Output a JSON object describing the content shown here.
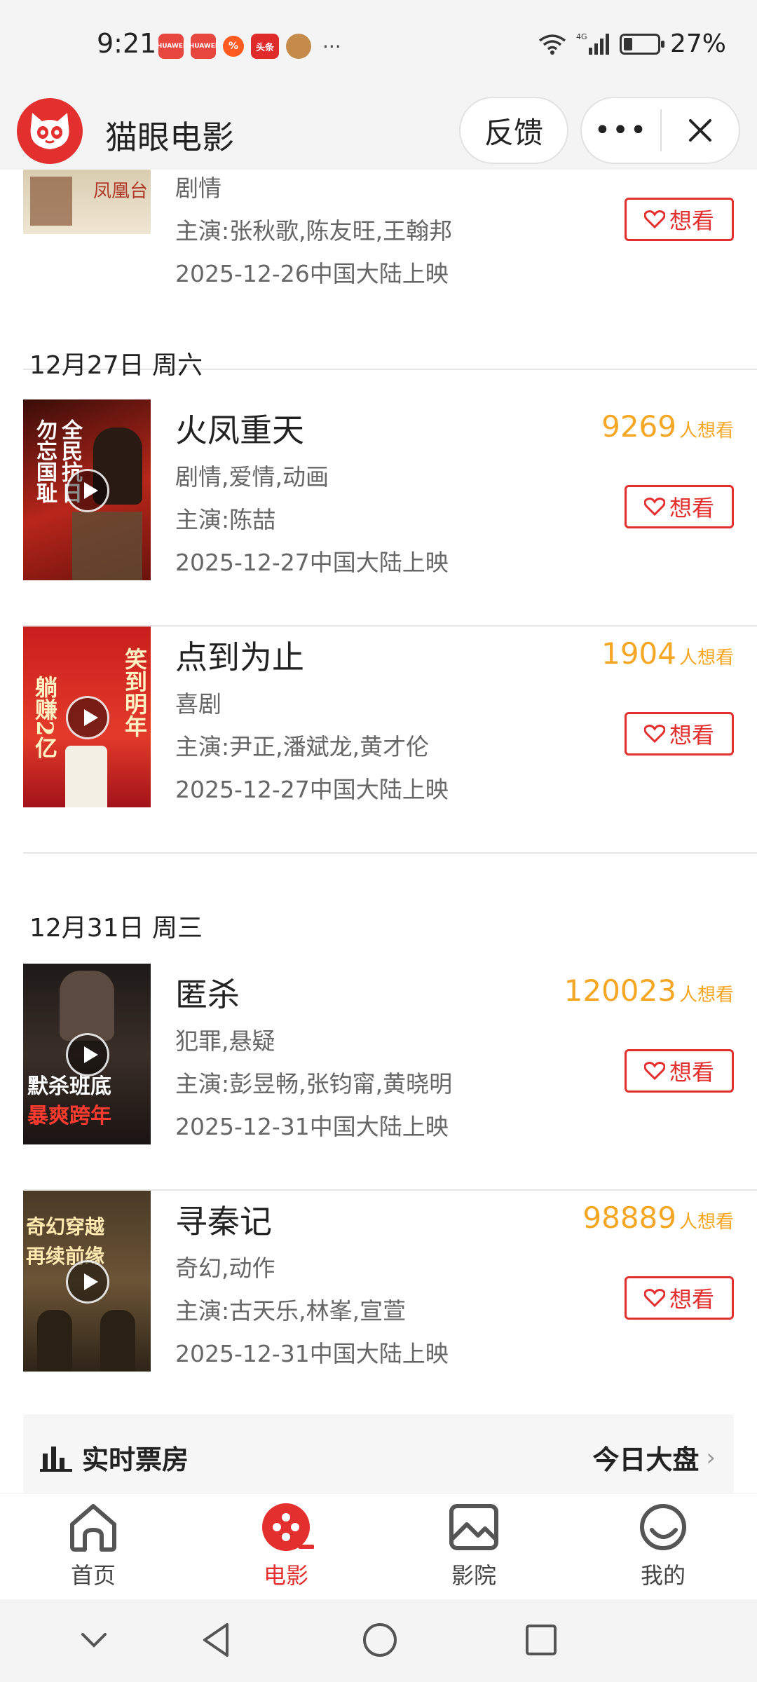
{
  "status": {
    "time": "9:21",
    "battery": "27%",
    "battery_level": 0.27,
    "network": "4G",
    "app_badges": [
      "HUAWEI",
      "HUAWEI",
      "%",
      "头条",
      "avatar"
    ]
  },
  "header": {
    "app_name": "猫眼电影",
    "feedback": "反馈",
    "more": "•••"
  },
  "partial_movie": {
    "genre": "剧情",
    "cast": "主演:张秋歌,陈友旺,王翰邦",
    "release": "2025-12-26中国大陆上映",
    "want_label": "想看"
  },
  "dates": [
    {
      "label": "12月27日 周六"
    },
    {
      "label": "12月31日 周三"
    }
  ],
  "movies": [
    {
      "title": "火凤重天",
      "genre": "剧情,爱情,动画",
      "cast": "主演:陈喆",
      "release": "2025-12-27中国大陆上映",
      "want_count": "9269",
      "want_suffix": "人想看",
      "want_label": "想看",
      "poster_text": [
        "勿忘国耻",
        "全民抗日"
      ]
    },
    {
      "title": "点到为止",
      "genre": "喜剧",
      "cast": "主演:尹正,潘斌龙,黄才伦",
      "release": "2025-12-27中国大陆上映",
      "want_count": "1904",
      "want_suffix": "人想看",
      "want_label": "想看",
      "poster_text": [
        "躺赚2亿",
        "笑到明年"
      ]
    },
    {
      "title": "匿杀",
      "genre": "犯罪,悬疑",
      "cast": "主演:彭昱畅,张钧甯,黄晓明",
      "release": "2025-12-31中国大陆上映",
      "want_count": "120023",
      "want_suffix": "人想看",
      "want_label": "想看",
      "poster_text": [
        "默杀班底",
        "暴爽跨年"
      ]
    },
    {
      "title": "寻秦记",
      "genre": "奇幻,动作",
      "cast": "主演:古天乐,林峯,宣萱",
      "release": "2025-12-31中国大陆上映",
      "want_count": "98889",
      "want_suffix": "人想看",
      "want_label": "想看",
      "poster_text": [
        "奇幻穿越",
        "再续前缘"
      ]
    }
  ],
  "boxoffice": {
    "left": "实时票房",
    "right": "今日大盘"
  },
  "nav": [
    {
      "label": "首页",
      "icon": "home-icon"
    },
    {
      "label": "电影",
      "icon": "film-reel-icon",
      "active": true
    },
    {
      "label": "影院",
      "icon": "picture-icon"
    },
    {
      "label": "我的",
      "icon": "profile-ring-icon"
    }
  ],
  "colors": {
    "accent": "#e3302e",
    "want_count": "#f5a623"
  }
}
